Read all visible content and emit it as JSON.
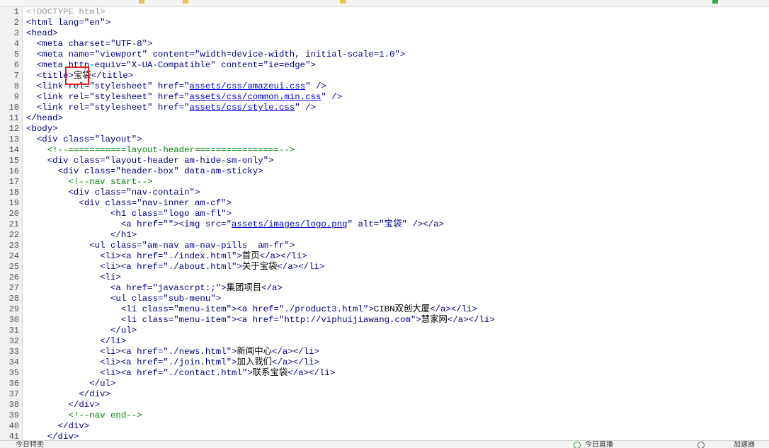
{
  "lines": [
    [
      {
        "t": "<!DOCTYPE html>",
        "c": "dt"
      }
    ],
    [
      {
        "t": "<html ",
        "c": "tg"
      },
      {
        "t": "lang=",
        "c": "at"
      },
      {
        "t": "\"en\"",
        "c": "st"
      },
      {
        "t": ">",
        "c": "tg"
      }
    ],
    [
      {
        "t": "<head>",
        "c": "tg"
      }
    ],
    [
      {
        "t": "  <meta ",
        "c": "tg"
      },
      {
        "t": "charset=",
        "c": "at"
      },
      {
        "t": "\"UTF-8\"",
        "c": "st"
      },
      {
        "t": ">",
        "c": "tg"
      }
    ],
    [
      {
        "t": "  <meta ",
        "c": "tg"
      },
      {
        "t": "name=",
        "c": "at"
      },
      {
        "t": "\"viewport\"",
        "c": "st"
      },
      {
        "t": " content=",
        "c": "at"
      },
      {
        "t": "\"width=device-width, initial-scale=1.0\"",
        "c": "st"
      },
      {
        "t": ">",
        "c": "tg"
      }
    ],
    [
      {
        "t": "  <meta ",
        "c": "tg"
      },
      {
        "t": "http-equiv=",
        "c": "at"
      },
      {
        "t": "\"X-UA-Compatible\"",
        "c": "st"
      },
      {
        "t": " content=",
        "c": "at"
      },
      {
        "t": "\"ie=edge\"",
        "c": "st"
      },
      {
        "t": ">",
        "c": "tg"
      }
    ],
    [
      {
        "t": "  <title>",
        "c": "tg"
      },
      {
        "t": "宝袋",
        "c": "ch"
      },
      {
        "t": "</title>",
        "c": "tg"
      }
    ],
    [
      {
        "t": "  <link ",
        "c": "tg"
      },
      {
        "t": "rel=",
        "c": "at"
      },
      {
        "t": "\"stylesheet\"",
        "c": "st"
      },
      {
        "t": " href=",
        "c": "at"
      },
      {
        "t": "\"",
        "c": "st"
      },
      {
        "t": "assets/css/amazeui.css",
        "c": "lk"
      },
      {
        "t": "\"",
        "c": "st"
      },
      {
        "t": " />",
        "c": "tg"
      }
    ],
    [
      {
        "t": "  <link ",
        "c": "tg"
      },
      {
        "t": "rel=",
        "c": "at"
      },
      {
        "t": "\"stylesheet\"",
        "c": "st"
      },
      {
        "t": " href=",
        "c": "at"
      },
      {
        "t": "\"",
        "c": "st"
      },
      {
        "t": "assets/css/common.min.css",
        "c": "lk"
      },
      {
        "t": "\"",
        "c": "st"
      },
      {
        "t": " />",
        "c": "tg"
      }
    ],
    [
      {
        "t": "  <link ",
        "c": "tg"
      },
      {
        "t": "rel=",
        "c": "at"
      },
      {
        "t": "\"stylesheet\"",
        "c": "st"
      },
      {
        "t": " href=",
        "c": "at"
      },
      {
        "t": "\"",
        "c": "st"
      },
      {
        "t": "assets/css/style.css",
        "c": "lk"
      },
      {
        "t": "\"",
        "c": "st"
      },
      {
        "t": " />",
        "c": "tg"
      }
    ],
    [
      {
        "t": "</head>",
        "c": "tg"
      }
    ],
    [
      {
        "t": "<body>",
        "c": "tg"
      }
    ],
    [
      {
        "t": "  <div ",
        "c": "tg"
      },
      {
        "t": "class=",
        "c": "at"
      },
      {
        "t": "\"layout\"",
        "c": "st"
      },
      {
        "t": ">",
        "c": "tg"
      }
    ],
    [
      {
        "t": "    <!--===========layout-header================-->",
        "c": "cm"
      }
    ],
    [
      {
        "t": "    <div ",
        "c": "tg"
      },
      {
        "t": "class=",
        "c": "at"
      },
      {
        "t": "\"layout-header am-hide-sm-only\"",
        "c": "st"
      },
      {
        "t": ">",
        "c": "tg"
      }
    ],
    [
      {
        "t": "      <div ",
        "c": "tg"
      },
      {
        "t": "class=",
        "c": "at"
      },
      {
        "t": "\"header-box\"",
        "c": "st"
      },
      {
        "t": " data-am-sticky>",
        "c": "at"
      }
    ],
    [
      {
        "t": "        <!--nav start-->",
        "c": "cm"
      }
    ],
    [
      {
        "t": "        <div ",
        "c": "tg"
      },
      {
        "t": "class=",
        "c": "at"
      },
      {
        "t": "\"nav-contain\"",
        "c": "st"
      },
      {
        "t": ">",
        "c": "tg"
      }
    ],
    [
      {
        "t": "          <div ",
        "c": "tg"
      },
      {
        "t": "class=",
        "c": "at"
      },
      {
        "t": "\"nav-inner am-cf\"",
        "c": "st"
      },
      {
        "t": ">",
        "c": "tg"
      }
    ],
    [
      {
        "t": "                <h1 ",
        "c": "tg"
      },
      {
        "t": "class=",
        "c": "at"
      },
      {
        "t": "\"logo am-fl\"",
        "c": "st"
      },
      {
        "t": ">",
        "c": "tg"
      }
    ],
    [
      {
        "t": "                  <a ",
        "c": "tg"
      },
      {
        "t": "href=",
        "c": "at"
      },
      {
        "t": "\"\"",
        "c": "st"
      },
      {
        "t": "><img ",
        "c": "tg"
      },
      {
        "t": "src=",
        "c": "at"
      },
      {
        "t": "\"",
        "c": "st"
      },
      {
        "t": "assets/images/logo.png",
        "c": "lk"
      },
      {
        "t": "\"",
        "c": "st"
      },
      {
        "t": " alt=",
        "c": "at"
      },
      {
        "t": "\"宝袋\"",
        "c": "st"
      },
      {
        "t": " /></a>",
        "c": "tg"
      }
    ],
    [
      {
        "t": "                </h1>",
        "c": "tg"
      }
    ],
    [
      {
        "t": "            <ul ",
        "c": "tg"
      },
      {
        "t": "class=",
        "c": "at"
      },
      {
        "t": "\"am-nav am-nav-pills  am-fr\"",
        "c": "st"
      },
      {
        "t": ">",
        "c": "tg"
      }
    ],
    [
      {
        "t": "              <li><a ",
        "c": "tg"
      },
      {
        "t": "href=",
        "c": "at"
      },
      {
        "t": "\"./index.html\"",
        "c": "st"
      },
      {
        "t": ">",
        "c": "tg"
      },
      {
        "t": "首页",
        "c": "pl"
      },
      {
        "t": "</a></li>",
        "c": "tg"
      }
    ],
    [
      {
        "t": "              <li><a ",
        "c": "tg"
      },
      {
        "t": "href=",
        "c": "at"
      },
      {
        "t": "\"./about.html\"",
        "c": "st"
      },
      {
        "t": ">",
        "c": "tg"
      },
      {
        "t": "关于宝袋",
        "c": "pl"
      },
      {
        "t": "</a></li>",
        "c": "tg"
      }
    ],
    [
      {
        "t": "              <li>",
        "c": "tg"
      }
    ],
    [
      {
        "t": "                <a ",
        "c": "tg"
      },
      {
        "t": "href=",
        "c": "at"
      },
      {
        "t": "\"javascrpt:;\"",
        "c": "st"
      },
      {
        "t": ">",
        "c": "tg"
      },
      {
        "t": "集团项目",
        "c": "pl"
      },
      {
        "t": "</a>",
        "c": "tg"
      }
    ],
    [
      {
        "t": "                <ul ",
        "c": "tg"
      },
      {
        "t": "class=",
        "c": "at"
      },
      {
        "t": "\"sub-menu\"",
        "c": "st"
      },
      {
        "t": ">",
        "c": "tg"
      }
    ],
    [
      {
        "t": "                  <li ",
        "c": "tg"
      },
      {
        "t": "class=",
        "c": "at"
      },
      {
        "t": "\"menu-item\"",
        "c": "st"
      },
      {
        "t": "><a ",
        "c": "tg"
      },
      {
        "t": "href=",
        "c": "at"
      },
      {
        "t": "\"./product3.html\"",
        "c": "st"
      },
      {
        "t": ">",
        "c": "tg"
      },
      {
        "t": "CIBN双创大厦",
        "c": "pl"
      },
      {
        "t": "</a></li>",
        "c": "tg"
      }
    ],
    [
      {
        "t": "                  <li ",
        "c": "tg"
      },
      {
        "t": "class=",
        "c": "at"
      },
      {
        "t": "\"menu-item\"",
        "c": "st"
      },
      {
        "t": "><a ",
        "c": "tg"
      },
      {
        "t": "href=",
        "c": "at"
      },
      {
        "t": "\"http://viphuijiawang.com\"",
        "c": "st"
      },
      {
        "t": ">",
        "c": "tg"
      },
      {
        "t": "慧家网",
        "c": "pl"
      },
      {
        "t": "</a></li>",
        "c": "tg"
      }
    ],
    [
      {
        "t": "                </ul>",
        "c": "tg"
      }
    ],
    [
      {
        "t": "              </li>",
        "c": "tg"
      }
    ],
    [
      {
        "t": "              <li><a ",
        "c": "tg"
      },
      {
        "t": "href=",
        "c": "at"
      },
      {
        "t": "\"./news.html\"",
        "c": "st"
      },
      {
        "t": ">",
        "c": "tg"
      },
      {
        "t": "新闻中心",
        "c": "pl"
      },
      {
        "t": "</a></li>",
        "c": "tg"
      }
    ],
    [
      {
        "t": "              <li><a ",
        "c": "tg"
      },
      {
        "t": "href=",
        "c": "at"
      },
      {
        "t": "\"./join.html\"",
        "c": "st"
      },
      {
        "t": ">",
        "c": "tg"
      },
      {
        "t": "加入我们",
        "c": "pl"
      },
      {
        "t": "</a></li>",
        "c": "tg"
      }
    ],
    [
      {
        "t": "              <li><a ",
        "c": "tg"
      },
      {
        "t": "href=",
        "c": "at"
      },
      {
        "t": "\"./contact.html\"",
        "c": "st"
      },
      {
        "t": ">",
        "c": "tg"
      },
      {
        "t": "联系宝袋",
        "c": "pl"
      },
      {
        "t": "</a></li>",
        "c": "tg"
      }
    ],
    [
      {
        "t": "            </ul>",
        "c": "tg"
      }
    ],
    [
      {
        "t": "          </div>",
        "c": "tg"
      }
    ],
    [
      {
        "t": "        </div>",
        "c": "tg"
      }
    ],
    [
      {
        "t": "        <!--nav end-->",
        "c": "cm"
      }
    ],
    [
      {
        "t": "      </div>",
        "c": "tg"
      }
    ],
    [
      {
        "t": "    </div>",
        "c": "tg"
      }
    ]
  ],
  "colors": {
    "tag": "#000080",
    "link": "#0000cc",
    "comment": "#008000",
    "doctype": "#9a9a9a",
    "highlight_box": "#e02020"
  },
  "status": {
    "left_label": "今日特卖",
    "live_label": "今日直播",
    "speed_label": "加速器"
  }
}
